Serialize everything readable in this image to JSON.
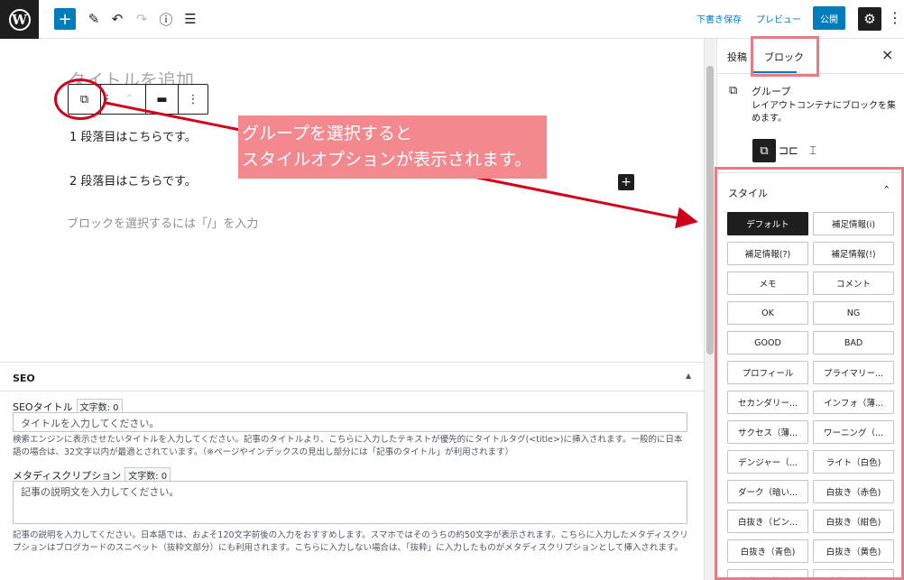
{
  "topbar": {
    "logo_letter": "W",
    "add_icon": "plus-icon",
    "tools_icon": "pen-icon",
    "undo_icon": "undo-icon",
    "redo_icon": "redo-icon",
    "info_icon": "info-icon",
    "list_view_icon": "list-view-icon",
    "save_draft": "下書き保存",
    "preview": "プレビュー",
    "publish": "公開",
    "settings_icon": "gear-icon",
    "options_icon": "kebab-icon"
  },
  "editor": {
    "title_placeholder": "タイトルを追加",
    "paragraph1": "1 段落目はこちらです。",
    "paragraph2": "2 段落目はこちらです。",
    "appender_placeholder": "ブロックを選択するには「/」を入力"
  },
  "block_toolbar": {
    "block_icon": "group-icon",
    "drag_icon": "drag-handle-icon",
    "move_icon": "chevron-up-icon",
    "align_icon": "align-icon",
    "more_icon": "kebab-icon"
  },
  "annotation": {
    "line1": "グループを選択すると",
    "line2": "スタイルオプションが表示されます。",
    "accent_color": "#d0021b",
    "box_color": "#e57c86"
  },
  "seo": {
    "heading": "SEO",
    "title_label": "SEOタイトル",
    "title_count": "文字数: 0",
    "title_placeholder": "タイトルを入力してください。",
    "title_help": "検索エンジンに表示させたいタイトルを入力してください。記事のタイトルより、こちらに入力したテキストが優先的にタイトルタグ(<title>)に挿入されます。一般的に日本語の場合は、32文字以内が最適とされています。（※ページやインデックスの見出し部分には「記事のタイトル」が利用されます）",
    "desc_label": "メタディスクリプション",
    "desc_count": "文字数: 0",
    "desc_placeholder": "記事の説明文を入力してください。",
    "desc_help": "記事の説明を入力してください。日本語では、およそ120文字前後の入力をおすすめします。スマホではそのうちの約50文字が表示されます。こちらに入力したメタディスクリプションはブログカードのスニペット（抜粋文部分）にも利用されます。こちらに入力しない場合は、「抜粋」に入力したものがメタディスクリプションとして挿入されます。"
  },
  "sidebar": {
    "tab_post": "投稿",
    "tab_block": "ブロック",
    "close_icon": "close-icon",
    "block_name": "グループ",
    "block_desc": "レイアウトコンテナにブロックを集めます。",
    "styles_heading": "スタイル",
    "styles": [
      "デフォルト",
      "補足情報(i)",
      "補足情報(?)",
      "補足情報(!)",
      "メモ",
      "コメント",
      "OK",
      "NG",
      "GOOD",
      "BAD",
      "プロフィール",
      "プライマリー...",
      "セカンダリー...",
      "インフォ（薄...",
      "サクセス（薄...",
      "ワーニング（...",
      "デンジャー（...",
      "ライト（白色)",
      "ダーク（暗い...",
      "白抜き（赤色)",
      "白抜き（ピン...",
      "白抜き（紺色)",
      "白抜き（青色)",
      "白抜き（黄色)",
      "白抜き（緑色)",
      "白抜き（灰..."
    ],
    "accent_color": "#007cba"
  }
}
